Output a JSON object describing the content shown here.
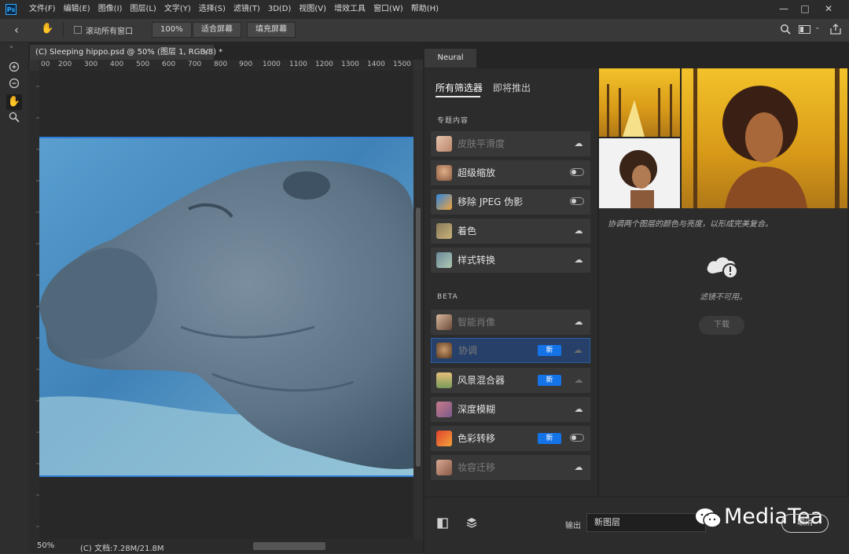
{
  "app": {
    "logo": "Ps",
    "menus": [
      "文件(F)",
      "编辑(E)",
      "图像(I)",
      "图层(L)",
      "文字(Y)",
      "选择(S)",
      "滤镜(T)",
      "3D(D)",
      "视图(V)",
      "增效工具",
      "窗口(W)",
      "帮助(H)"
    ]
  },
  "options_bar": {
    "scroll_all_label": "滚动所有窗口",
    "zoom_value": "100%",
    "fit_screen_label": "适合屏幕",
    "fill_screen_label": "填充屏幕"
  },
  "document": {
    "tab_title": "(C) Sleeping hippo.psd @ 50% (图层 1, RGB/8) *",
    "close_glyph": "×",
    "ruler_h": [
      "00",
      "200",
      "300",
      "400",
      "500",
      "600",
      "700",
      "800",
      "900",
      "1000",
      "1100",
      "1200",
      "1300",
      "1400",
      "1500"
    ],
    "status_zoom": "50%",
    "status_doc": "(C) 文档:7.28M/21.8M"
  },
  "panel": {
    "tab": "Neural Filters",
    "tabs": [
      "所有筛选器",
      "即将推出"
    ],
    "section_featured": "专题内容",
    "section_beta": "BETA",
    "featured": [
      {
        "name": "皮肤平滑度",
        "state": "cloud",
        "dim": true
      },
      {
        "name": "超级缩放",
        "state": "toggle",
        "dim": false
      },
      {
        "name": "移除 JPEG 伪影",
        "state": "toggle",
        "dim": false
      },
      {
        "name": "着色",
        "state": "cloud",
        "dim": false
      },
      {
        "name": "样式转换",
        "state": "cloud",
        "dim": false
      }
    ],
    "beta": [
      {
        "name": "智能肖像",
        "state": "cloud",
        "dim": true
      },
      {
        "name": "协调",
        "state": "cloud-dim",
        "dim": true,
        "badge": "新",
        "active": true
      },
      {
        "name": "风景混合器",
        "state": "cloud-dim",
        "dim": false,
        "badge": "新"
      },
      {
        "name": "深度模糊",
        "state": "cloud",
        "dim": false
      },
      {
        "name": "色彩转移",
        "state": "toggle",
        "dim": false,
        "badge": "新"
      },
      {
        "name": "妆容迁移",
        "state": "cloud",
        "dim": true
      }
    ],
    "description": "协调两个图层的颜色与亮度，以形成完美复合。",
    "unavailable": "滤镜不可用。",
    "download_label": "下载",
    "output_label": "输出",
    "output_value": "新图层",
    "cancel_label": "取消"
  },
  "watermark": "MediaTea",
  "colors": {
    "accent": "#1473e6",
    "active_row": "#26406a",
    "selection": "#2f7cd6"
  }
}
